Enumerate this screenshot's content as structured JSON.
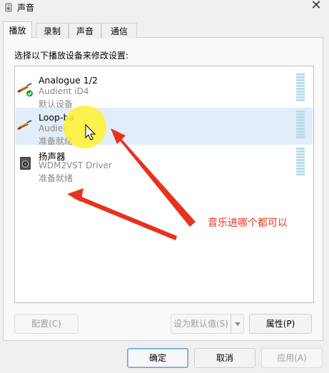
{
  "window": {
    "title": "声音"
  },
  "tabs": [
    {
      "label": "播放",
      "active": true
    },
    {
      "label": "录制"
    },
    {
      "label": "声音"
    },
    {
      "label": "通信"
    }
  ],
  "instruction": "选择以下播放设备来修改设置:",
  "devices": [
    {
      "name": "Analogue 1/2",
      "driver": "Audient iD4",
      "status": "默认设备",
      "icon": "speaker-cable-default-icon"
    },
    {
      "name": "Loop-ba",
      "driver": "Audien",
      "status": "准备就绪",
      "icon": "speaker-cable-icon",
      "selected": true
    },
    {
      "name": "扬声器",
      "driver": "WDM2VST Driver",
      "status": "准备就绪",
      "icon": "speaker-box-icon"
    }
  ],
  "buttons": {
    "configure": "配置(C)",
    "set_default": "设为默认值(S)",
    "properties": "属性(P)",
    "ok": "确定",
    "cancel": "取消",
    "apply": "应用(A)"
  },
  "annotation": {
    "text": "音乐进哪个都可以",
    "color": "#e8321e"
  },
  "colors": {
    "selection": "#e1edf8",
    "meter": "#b8dbe6",
    "highlight": "#fff134"
  }
}
